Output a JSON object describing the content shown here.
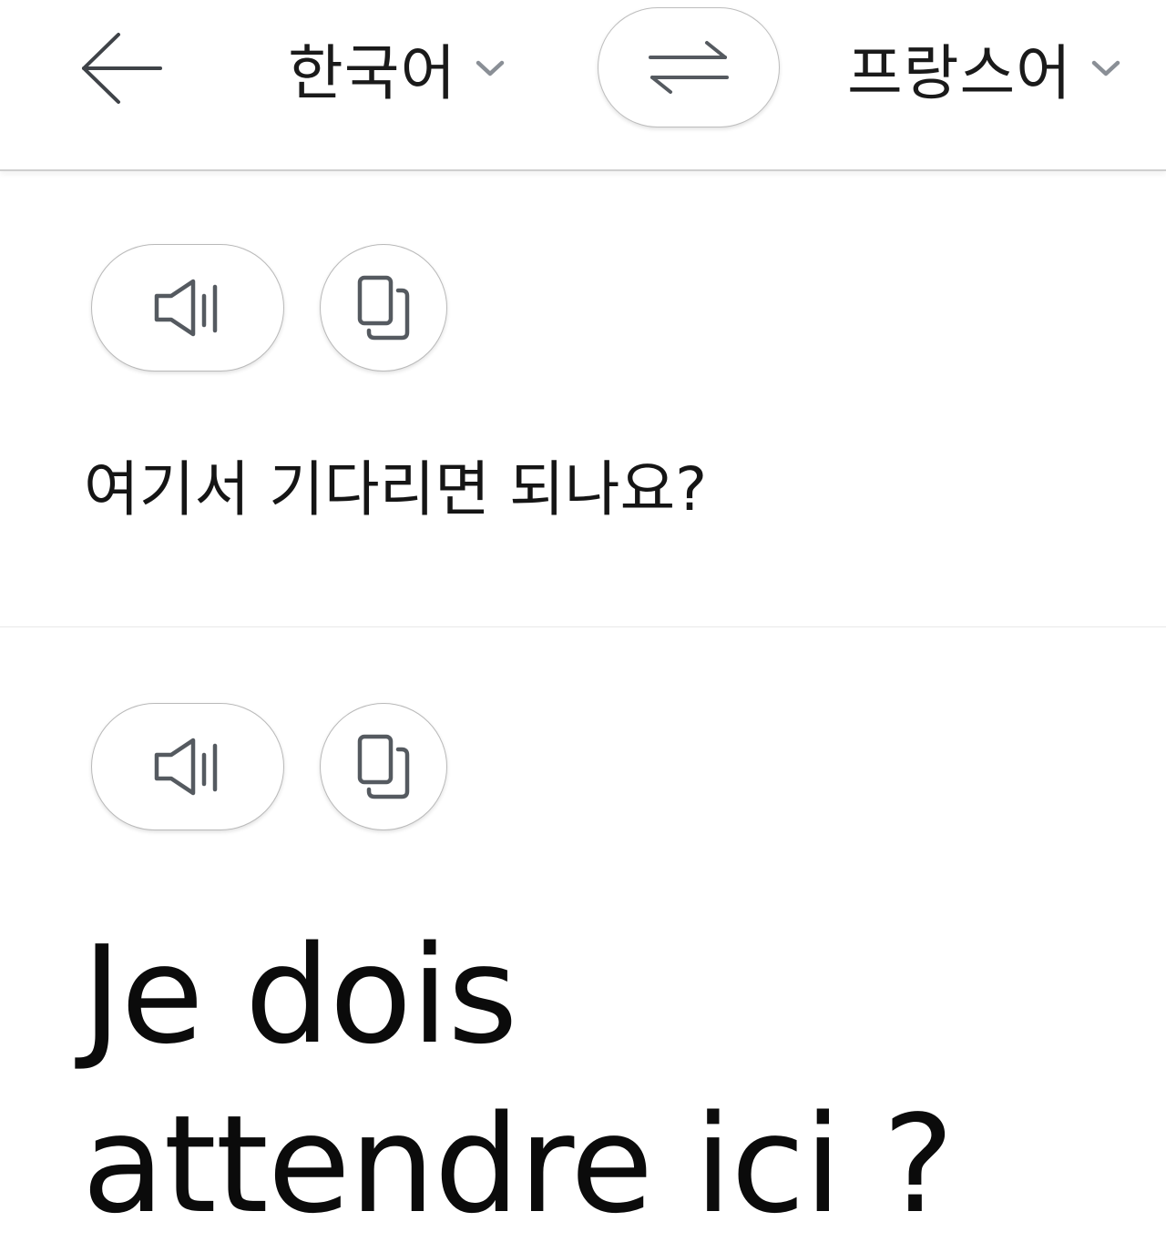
{
  "header": {
    "back_icon": "arrow-left-icon",
    "source_language": "한국어",
    "target_language": "프랑스어",
    "swap_icon": "swap-arrows-icon",
    "dropdown_icon": "chevron-down-icon"
  },
  "source": {
    "speak_icon": "speaker-icon",
    "copy_icon": "copy-icon",
    "text": "여기서 기다리면 되나요?"
  },
  "translation": {
    "speak_icon": "speaker-icon",
    "copy_icon": "copy-icon",
    "text": "Je dois attendre ici ?"
  },
  "colors": {
    "icon": "#555a60",
    "chevron": "#8a8f96",
    "text": "#111111",
    "divider": "#cfcfcf"
  }
}
